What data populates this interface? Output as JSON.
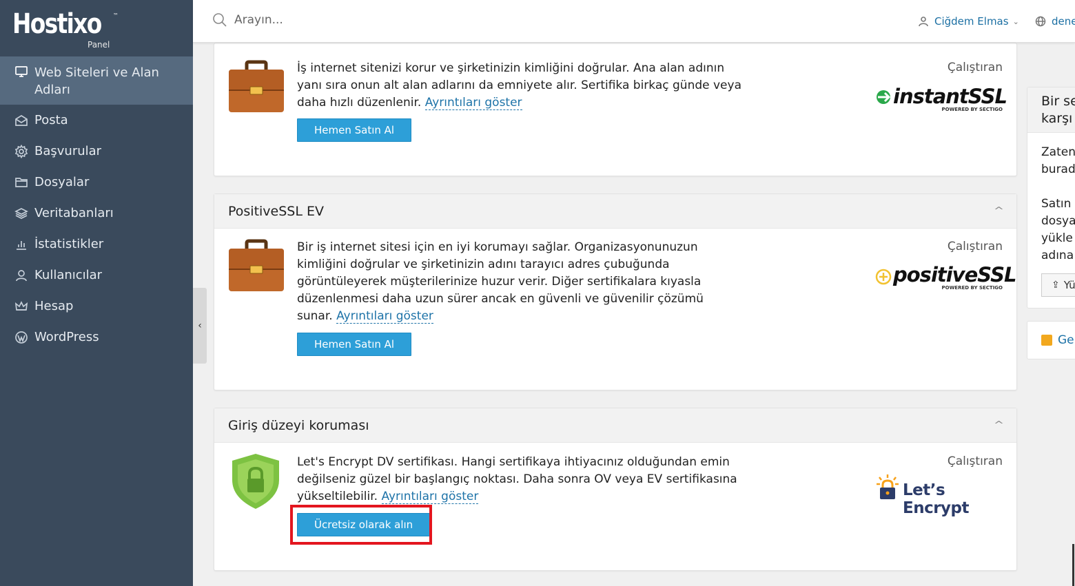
{
  "brand": {
    "name": "Hostixo",
    "tm": "™",
    "sub": "Panel"
  },
  "sidebar": {
    "items": [
      {
        "label": "Web Siteleri ve Alan Adları",
        "icon": "monitor-icon",
        "active": true
      },
      {
        "label": "Posta",
        "icon": "mail-icon"
      },
      {
        "label": "Başvurular",
        "icon": "gear-icon"
      },
      {
        "label": "Dosyalar",
        "icon": "folder-icon"
      },
      {
        "label": "Veritabanları",
        "icon": "database-icon"
      },
      {
        "label": "İstatistikler",
        "icon": "bar-chart-icon"
      },
      {
        "label": "Kullanıcılar",
        "icon": "user-icon"
      },
      {
        "label": "Hesap",
        "icon": "crown-icon"
      },
      {
        "label": "WordPress",
        "icon": "wordpress-icon"
      }
    ]
  },
  "topbar": {
    "search_placeholder": "Arayın...",
    "user_name": "Ciğdem Elmas",
    "lang_label": "dene"
  },
  "cards": [
    {
      "title": "",
      "description": "İş internet sitenizi korur ve şirketinizin kimliğini doğrular. Ana alan adının yanı sıra onun alt alan adlarını da emniyete alır. Sertifika birkaç günde veya daha hızlı düzenlenir.",
      "details_link": "Ayrıntıları göster",
      "button": "Hemen Satın Al",
      "run_by": "Çalıştıran",
      "brand_main": "instantSSL",
      "brand_sub": "POWERED BY SECTIGO",
      "icon": "briefcase-icon"
    },
    {
      "title": "PositiveSSL EV",
      "description": "Bir iş internet sitesi için en iyi korumayı sağlar. Organizasyonunuzun kimliğini doğrular ve şirketinizin adını tarayıcı adres çubuğunda görüntüleyerek müşterilerinize huzur verir. Diğer sertifikalara kıyasla düzenlenmesi daha uzun sürer ancak en güvenli ve güvenilir çözümü sunar.",
      "details_link": "Ayrıntıları göster",
      "button": "Hemen Satın Al",
      "run_by": "Çalıştıran",
      "brand_main": "positiveSSL",
      "brand_sub": "POWERED BY SECTIGO",
      "icon": "briefcase-icon"
    },
    {
      "title": "Giriş düzeyi koruması",
      "description": "Let's Encrypt DV sertifikası. Hangi sertifikaya ihtiyacınız olduğundan emin değilseniz güzel bir başlangıç noktası. Daha sonra OV veya EV sertifikasına yükseltilebilir.",
      "details_link": "Ayrıntıları göster",
      "button": "Ücretsiz olarak alın",
      "run_by": "Çalıştıran",
      "brand_main": "Let’s Encrypt",
      "icon": "shield-lock-icon"
    }
  ],
  "right_panel": {
    "title": "Bir se\nkarşı",
    "text": "Zaten\nburad\n\nSatın \ndosya\nyükle\nadına",
    "button": "Yü",
    "link": "Ge"
  },
  "colors": {
    "sidebar": "#3a4a5c",
    "sidebar_active": "#566a7f",
    "button": "#2d9fd8",
    "link": "#1e73a8",
    "highlight": "#e3161f"
  }
}
